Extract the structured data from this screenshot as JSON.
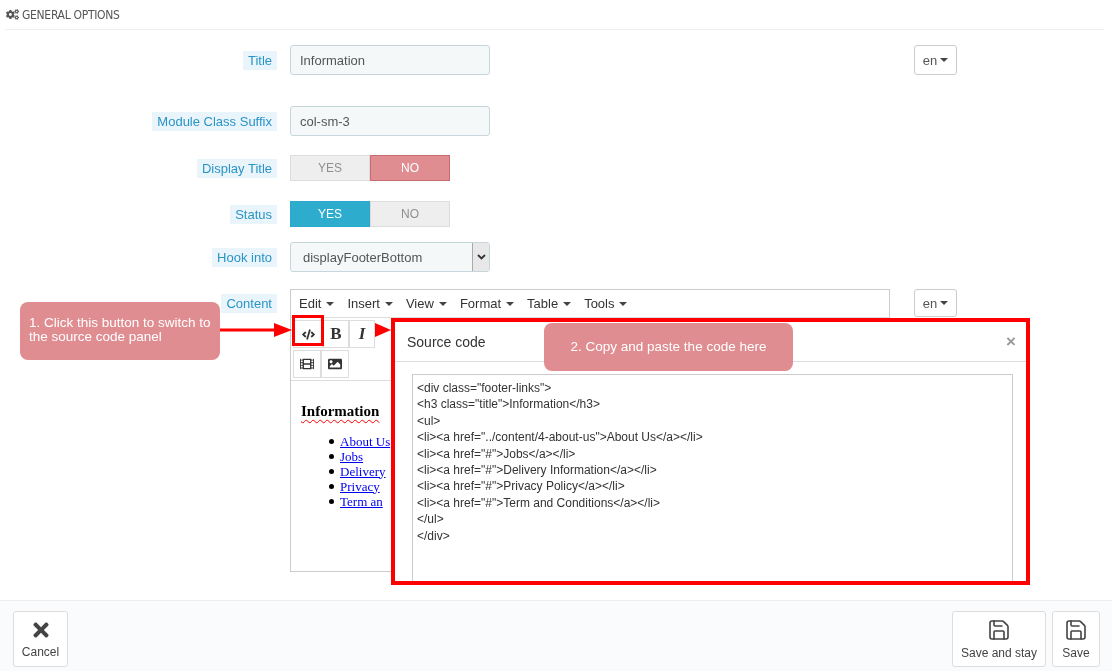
{
  "panel": {
    "title": "GENERAL OPTIONS"
  },
  "fields": [
    {
      "kind": "text",
      "label": "Title",
      "value": "Information",
      "lang": "en"
    },
    {
      "kind": "text",
      "label": "Module Class Suffix",
      "value": "col-sm-3"
    },
    {
      "kind": "toggle",
      "label": "Display Title",
      "options": [
        {
          "label": "YES",
          "selected": false
        },
        {
          "label": "NO",
          "selected": true
        }
      ]
    },
    {
      "kind": "toggle",
      "label": "Status",
      "options": [
        {
          "label": "YES",
          "selected": true
        },
        {
          "label": "NO",
          "selected": false
        }
      ]
    },
    {
      "kind": "select",
      "label": "Hook into",
      "value": "displayFooterBottom"
    }
  ],
  "editor": {
    "label": "Content",
    "lang": "en",
    "menus": [
      "Edit",
      "Insert",
      "View",
      "Format",
      "Table",
      "Tools"
    ],
    "format_buttons": [
      "B",
      "I"
    ],
    "heading": "Information",
    "links": [
      "About Us",
      "Jobs",
      "Delivery",
      "Privacy",
      "Term an"
    ]
  },
  "source_dialog": {
    "title": "Source code",
    "close": "×",
    "lines": [
      "<div class=\"footer-links\">",
      "<h3 class=\"title\">Information</h3>",
      "<ul>",
      "<li><a href=\"../content/4-about-us\">About Us</a></li>",
      "<li><a href=\"#\">Jobs</a></li>",
      "<li><a href=\"#\">Delivery Information</a></li>",
      "<li><a href=\"#\">Privacy Policy</a></li>",
      "<li><a href=\"#\">Term and Conditions</a></li>",
      "</ul>",
      "</div>"
    ]
  },
  "callouts": [
    "1. Click this button to switch to the source code panel",
    "2. Copy and paste the code here"
  ],
  "footer": {
    "cancel": "Cancel",
    "buttons": [
      "Save and stay",
      "Save"
    ]
  }
}
